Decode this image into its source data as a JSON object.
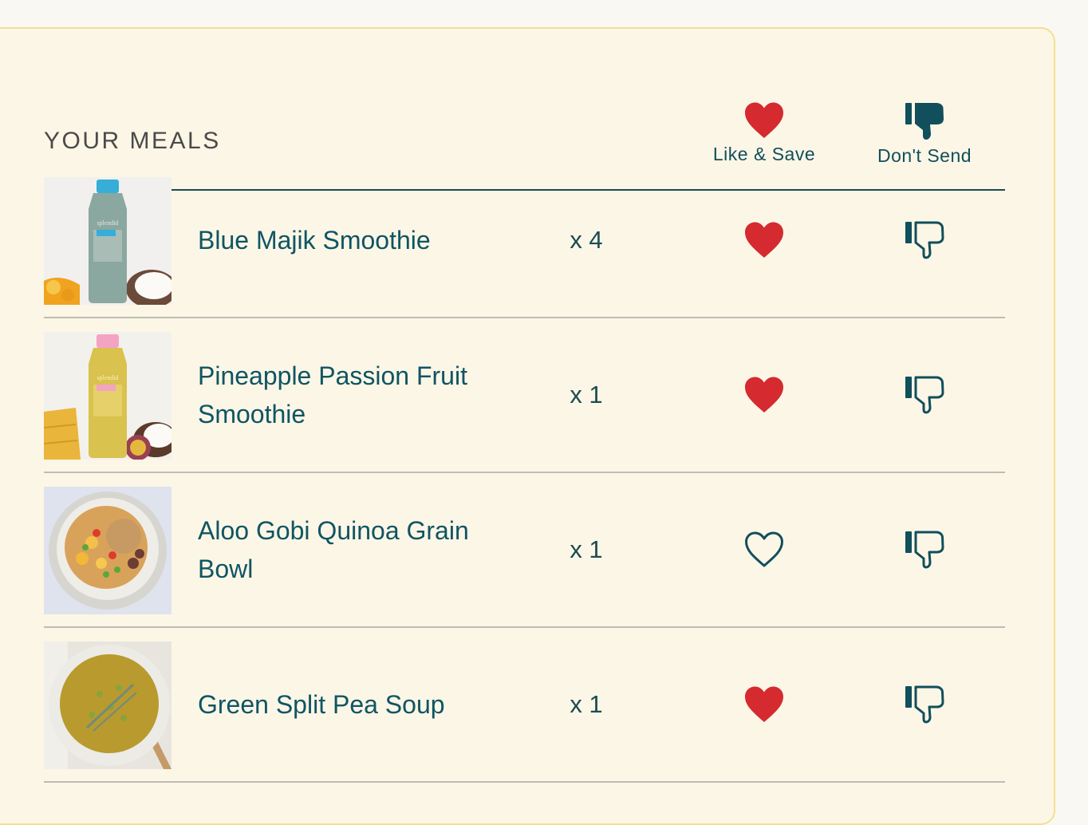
{
  "header": {
    "title": "YOUR MEALS",
    "like_label": "Like & Save",
    "dont_label": "Don't Send"
  },
  "colors": {
    "accent": "#114f5c",
    "heart_filled": "#d42a30",
    "panel_bg": "#fcf6e6",
    "panel_border": "#f3e08f"
  },
  "meals": [
    {
      "name": "Blue Majik Smoothie",
      "quantity": "x 4",
      "liked": true,
      "image": "blue-smoothie-bottle"
    },
    {
      "name": "Pineapple Passion Fruit Smoothie",
      "quantity": "x 1",
      "liked": true,
      "image": "yellow-smoothie-bottle"
    },
    {
      "name": "Aloo Gobi Quinoa Grain Bowl",
      "quantity": "x 1",
      "liked": false,
      "image": "grain-bowl"
    },
    {
      "name": "Green Split Pea Soup",
      "quantity": "x 1",
      "liked": true,
      "image": "pea-soup-bowl"
    }
  ]
}
